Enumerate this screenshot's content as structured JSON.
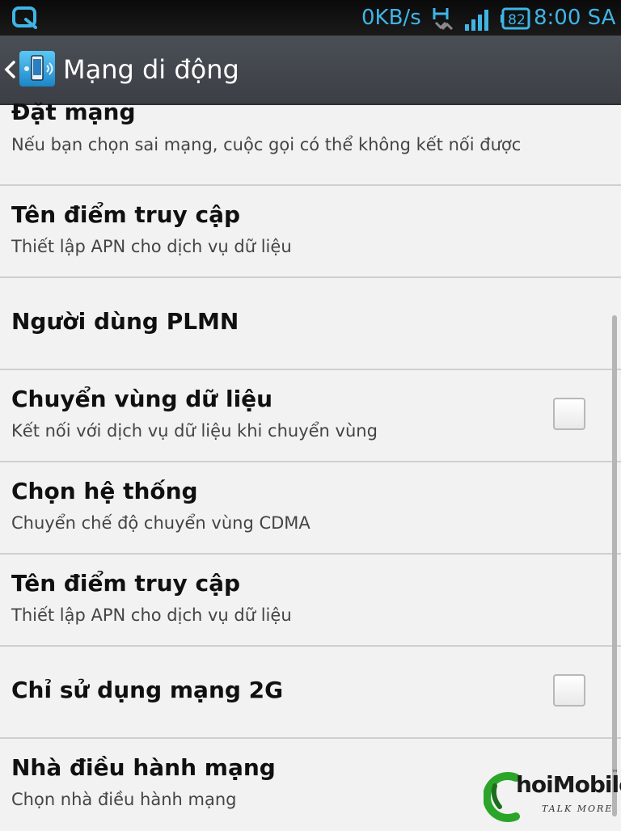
{
  "status_bar": {
    "speed": "0KB/s",
    "battery_level": "82",
    "time": "8:00 SA",
    "left_icon": "q-notification-icon",
    "data_icon": "data-transfer-icon",
    "signal_icon": "signal-strength-icon",
    "accent_color": "#3fb5e6"
  },
  "action_bar": {
    "title": "Mạng di động",
    "back_icon": "chevron-left-icon",
    "app_icon": "mobile-network-icon"
  },
  "settings": [
    {
      "title": "Đặt mạng",
      "summary": "Nếu bạn chọn sai mạng, cuộc gọi có thể không kết nối được"
    },
    {
      "title": "Tên điểm truy cập",
      "summary": "Thiết lập APN cho dịch vụ dữ liệu"
    },
    {
      "title": "Người dùng PLMN",
      "summary": ""
    },
    {
      "title": "Chuyển vùng dữ liệu",
      "summary": "Kết nối với dịch vụ dữ liệu khi chuyển vùng",
      "checked": false
    },
    {
      "title": "Chọn hệ thống",
      "summary": "Chuyển chế độ chuyển vùng CDMA"
    },
    {
      "title": "Tên điểm truy cập",
      "summary": "Thiết lập APN cho dịch vụ dữ liệu"
    },
    {
      "title": "Chỉ sử dụng mạng 2G",
      "summary": "",
      "checked": false
    },
    {
      "title": "Nhà điều hành mạng",
      "summary": "Chọn nhà điều hành mạng"
    }
  ],
  "watermark": {
    "brand": "ChoiMobile",
    "brand_rest": "hoiMobile",
    "tagline": "TALK MORE",
    "tm": "™"
  }
}
